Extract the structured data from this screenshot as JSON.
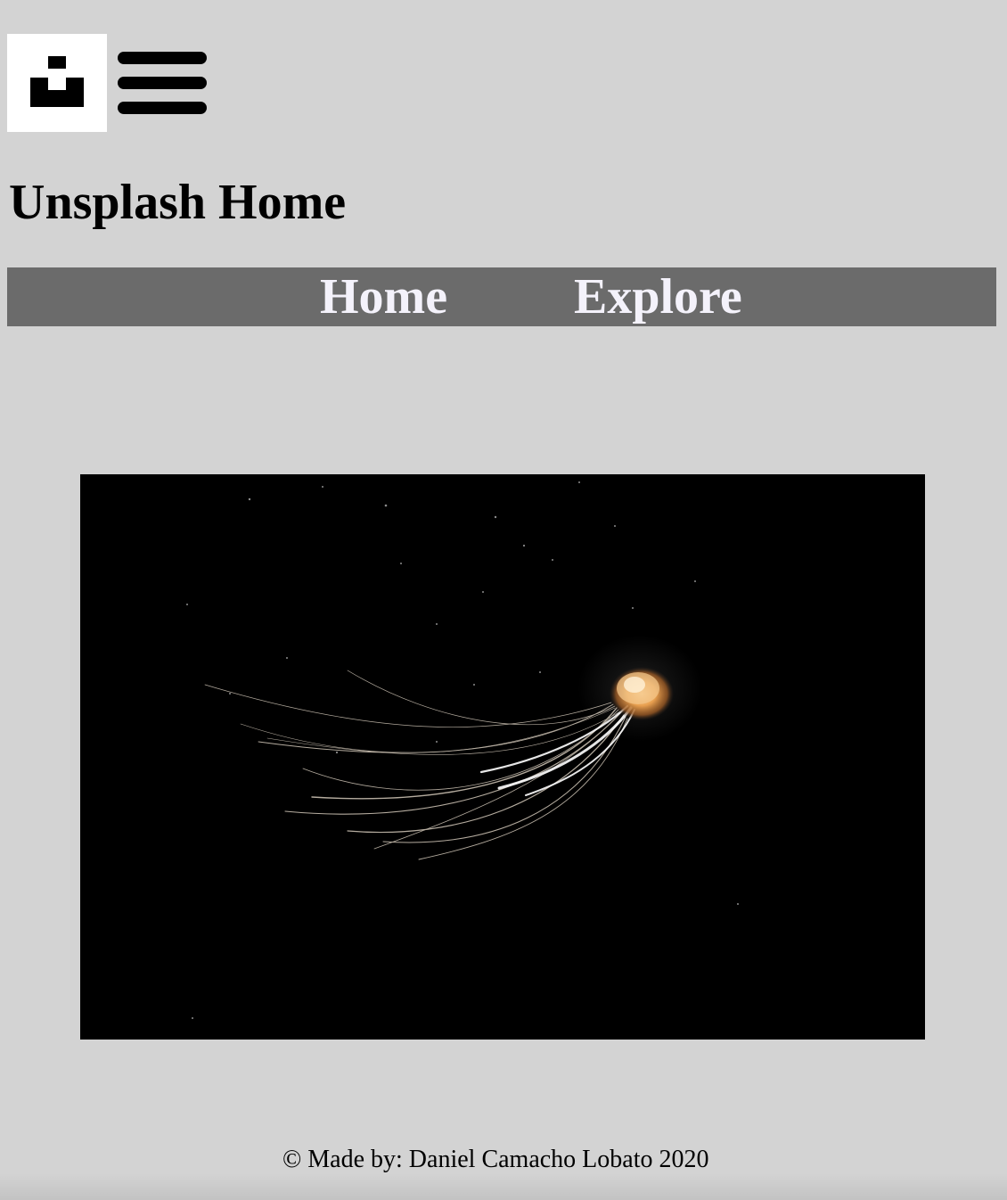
{
  "header": {
    "logo_icon": "unsplash-logo-icon",
    "menu_icon": "hamburger-menu-icon"
  },
  "page": {
    "title": "Unsplash Home"
  },
  "nav": {
    "items": [
      {
        "label": "Home"
      },
      {
        "label": "Explore"
      }
    ]
  },
  "main": {
    "photo_subject": "jellyfish-photo"
  },
  "footer": {
    "text": "© Made by: Daniel Camacho Lobato 2020"
  },
  "colors": {
    "page_background": "#d3d3d3",
    "nav_background": "#6b6b6b",
    "nav_text": "#f4f2fb"
  }
}
